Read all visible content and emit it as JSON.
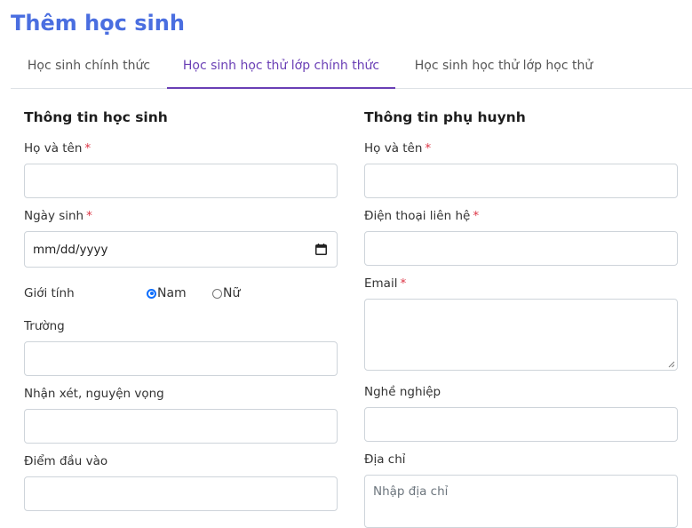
{
  "page": {
    "title": "Thêm học sinh"
  },
  "tabs": [
    {
      "label": "Học sinh chính thức",
      "active": false
    },
    {
      "label": "Học sinh học thử lớp chính thức",
      "active": true
    },
    {
      "label": "Học sinh học thử lớp học thử",
      "active": false
    }
  ],
  "student": {
    "section_title": "Thông tin học sinh",
    "full_name_label": "Họ và tên",
    "full_name_value": "",
    "birth_date_label": "Ngày sinh",
    "birth_date_placeholder": "mm/dd/yyyy",
    "gender_label": "Giới tính",
    "gender_options": [
      {
        "label": "Nam",
        "checked": true
      },
      {
        "label": "Nữ",
        "checked": false
      }
    ],
    "school_label": "Trường",
    "school_value": "",
    "comments_label": "Nhận xét, nguyện vọng",
    "comments_value": "",
    "entry_score_label": "Điểm đầu vào",
    "entry_score_value": ""
  },
  "parent": {
    "section_title": "Thông tin phụ huynh",
    "full_name_label": "Họ và tên",
    "full_name_value": "",
    "phone_label": "Điện thoại liên hệ",
    "phone_value": "",
    "email_label": "Email",
    "email_value": "",
    "occupation_label": "Nghề nghiệp",
    "occupation_value": "",
    "address_label": "Địa chỉ",
    "address_placeholder": "Nhập địa chỉ"
  },
  "required_marker": "*",
  "colors": {
    "title": "#4a6ee0",
    "active_tab": "#6a3fb5",
    "required": "#dc3545",
    "radio": "#0d6efd"
  }
}
